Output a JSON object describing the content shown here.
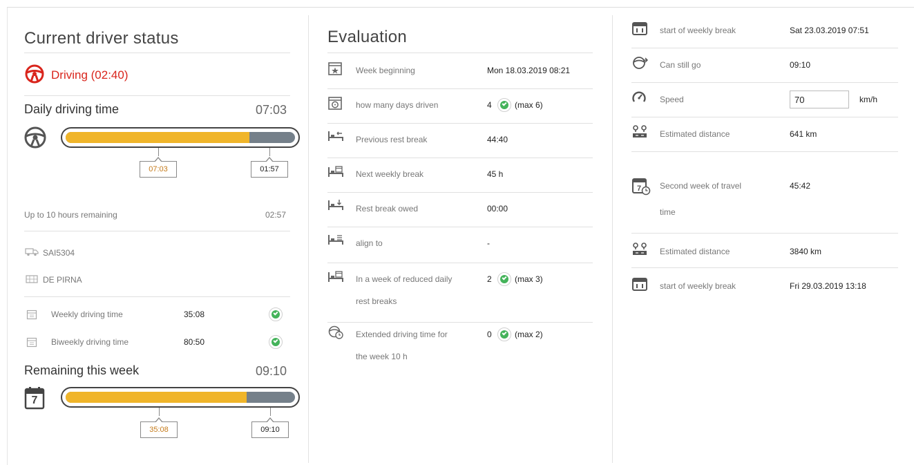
{
  "left": {
    "title": "Current driver status",
    "status": "Driving (02:40)",
    "daily": {
      "label": "Daily driving time",
      "time": "07:03",
      "progress": 0.8,
      "marker_done": "07:03",
      "marker_left": "01:57"
    },
    "remaining_label": "Up to 10 hours remaining",
    "remaining_value": "02:57",
    "vehicle": "SAI5304",
    "location": "DE PIRNA",
    "weekly_label": "Weekly driving time",
    "weekly_value": "35:08",
    "biweekly_label": "Biweekly driving time",
    "biweekly_value": "80:50",
    "week": {
      "label": "Remaining this week",
      "time": "09:10",
      "progress": 0.79,
      "calendar_number": "7",
      "marker_done": "35:08",
      "marker_left": "09:10"
    }
  },
  "middle": {
    "title": "Evaluation",
    "rows": [
      {
        "label": "Week beginning",
        "value": "Mon 18.03.2019 08:21",
        "icon": "calendar-star-icon"
      },
      {
        "label": "how many days driven",
        "value": "4",
        "suffix": "(max 6)",
        "icon": "calendar-wheel-icon"
      },
      {
        "label": "Previous rest break",
        "value": "44:40",
        "icon": "bed-back-icon"
      },
      {
        "label": "Next weekly break",
        "value": "45 h",
        "icon": "bed-calendar-icon"
      },
      {
        "label": "Rest break owed",
        "value": "00:00",
        "icon": "bed-down-icon"
      },
      {
        "label": "align to",
        "value": "-",
        "icon": "bed-lines-icon"
      },
      {
        "label": "In a week of reduced daily",
        "label2": "rest breaks",
        "value": "2",
        "suffix": "(max 3)",
        "icon": "bed-calendar-icon"
      },
      {
        "label": "Extended driving time for",
        "label2": "the week 10 h",
        "value": "0",
        "suffix": "(max 2)",
        "icon": "wheel-clock-icon"
      }
    ]
  },
  "right": {
    "rows": [
      {
        "label": "start of weekly break",
        "value": "Sat 23.03.2019 07:51",
        "icon": "calendar-icon"
      },
      {
        "label": "Can still go",
        "value": "09:10",
        "icon": "wheel-arrow-icon"
      },
      {
        "label": "Speed",
        "input_value": "70",
        "unit": "km/h",
        "icon": "speedometer-icon"
      },
      {
        "label": "Estimated distance",
        "value": "641 km",
        "icon": "distance-icon"
      },
      {
        "label": "Second week of travel",
        "label2": "time",
        "value": "45:42",
        "icon": "calendar-clock-icon"
      },
      {
        "label": "Estimated distance",
        "value": "3840 km",
        "icon": "distance-icon"
      },
      {
        "label": "start of weekly break",
        "value": "Fri 29.03.2019 13:18",
        "icon": "calendar-icon"
      }
    ]
  },
  "colors": {
    "accent_red": "#d9251c",
    "bar_fill": "#f0b52a",
    "bar_rest": "#75808a",
    "check_green": "#44b35a"
  }
}
